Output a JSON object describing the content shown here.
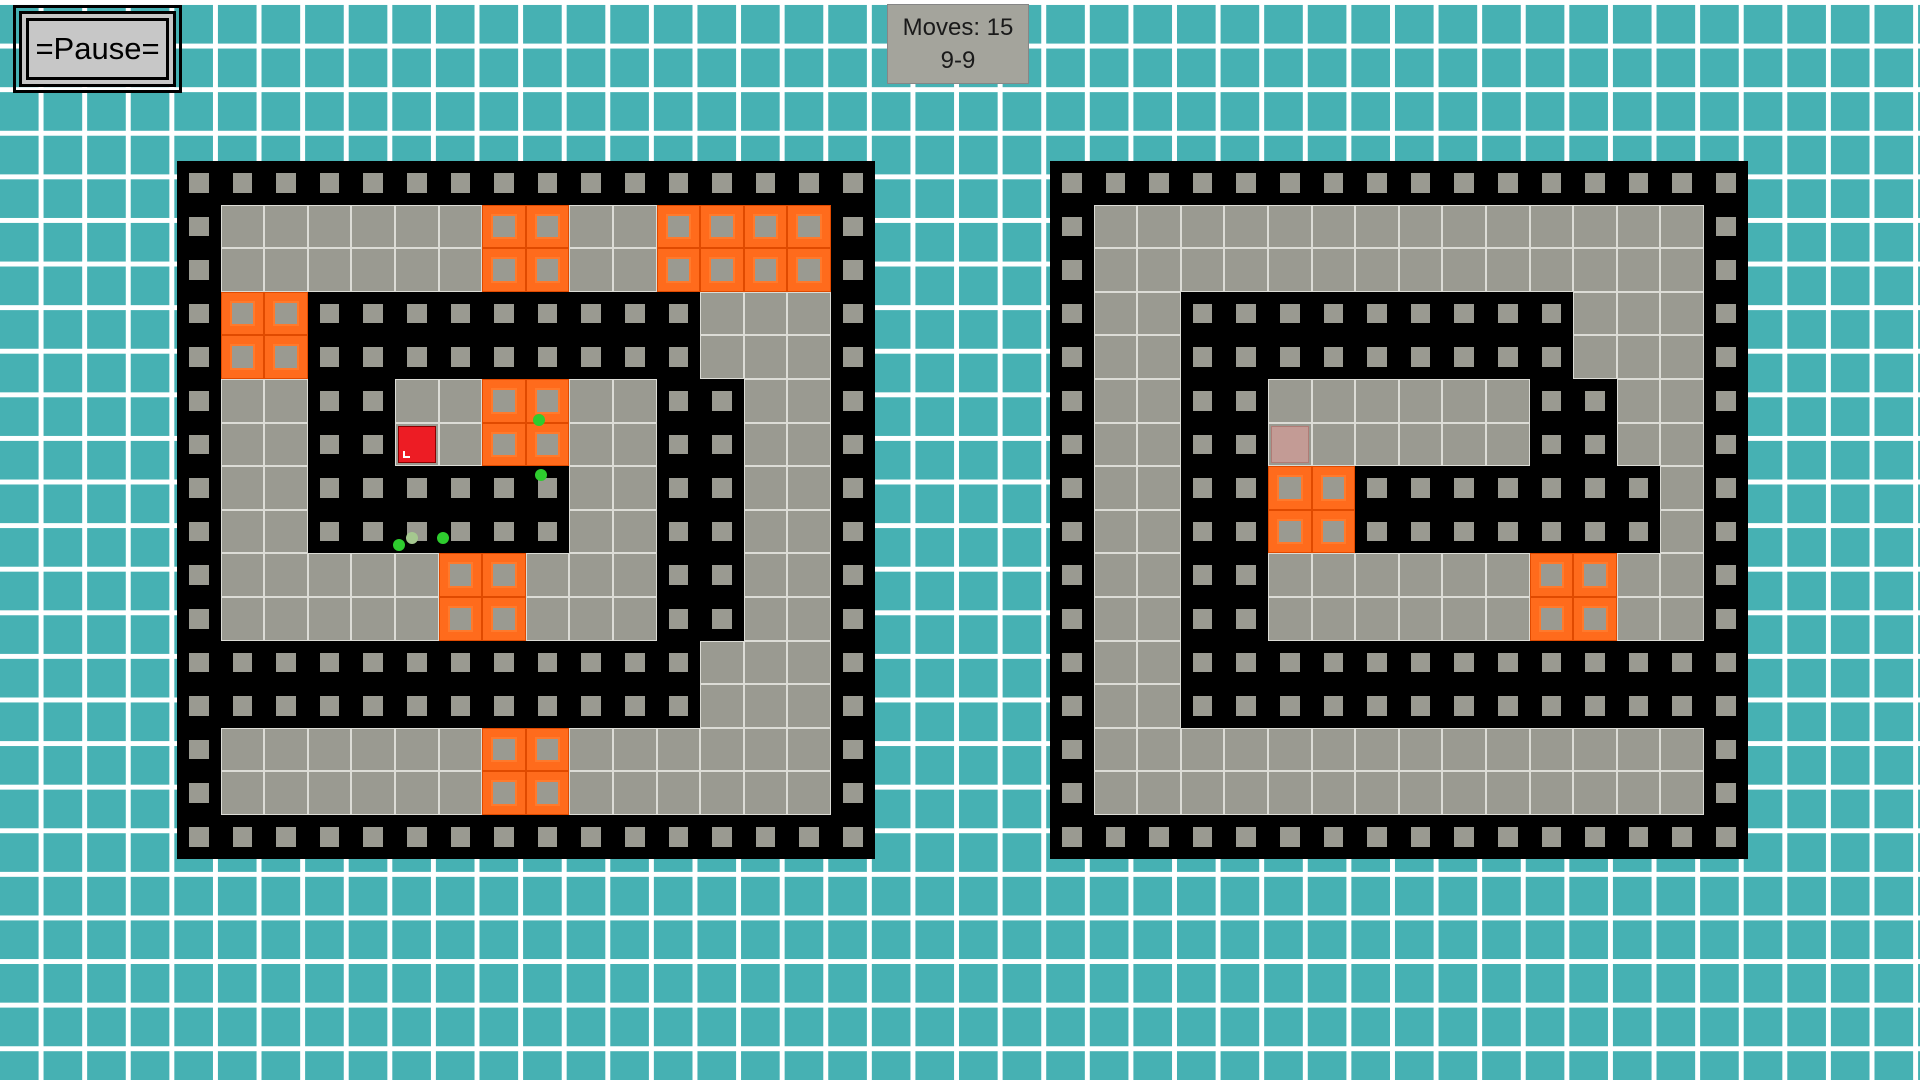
{
  "pause_label": "=Pause=",
  "hud": {
    "moves_label": "Moves: 15",
    "level_label": "9-9"
  },
  "colors": {
    "background": "#46b1b3",
    "gridline": "#ffffff",
    "wall": "#000000",
    "floor": "#9a9a91",
    "hot_tile": "#ff6b1c",
    "player": "#ed1c24",
    "marker": "#2ecc2e"
  },
  "legend": {
    "#": "wall",
    ".": "floor",
    "O": "orange tile",
    "P": "player",
    "G": "player ghost"
  },
  "boards": [
    {
      "name": "left",
      "rows": [
        "################",
        "#......OO..OOOO#",
        "#......OO..OOOO#",
        "#OO#########...#",
        "#OO#########...#",
        "#..##..OO..##..#",
        "#..##P.OO..##..#",
        "#..######..##..#",
        "#..######..##..#",
        "#.....OO...##..#",
        "#.....OO...##..#",
        "############...#",
        "############...#",
        "#......OO......#",
        "#......OO......#",
        "################"
      ],
      "markers": [
        {
          "col": 8.3,
          "row": 5.95,
          "style": "bright"
        },
        {
          "col": 8.35,
          "row": 7.2,
          "style": "bright"
        },
        {
          "col": 5.1,
          "row": 8.8,
          "style": "bright"
        },
        {
          "col": 5.4,
          "row": 8.65,
          "style": "faded"
        },
        {
          "col": 6.1,
          "row": 8.65,
          "style": "bright"
        }
      ]
    },
    {
      "name": "right",
      "rows": [
        "################",
        "#..............#",
        "#..............#",
        "#..#########...#",
        "#..#########...#",
        "#..##......##..#",
        "#..##G.....##..#",
        "#..##OO#######.#",
        "#..##OO#######.#",
        "#..##......OO..#",
        "#..##......OO..#",
        "#..#############",
        "#..#############",
        "#..............#",
        "#..............#",
        "################"
      ],
      "markers": []
    }
  ]
}
